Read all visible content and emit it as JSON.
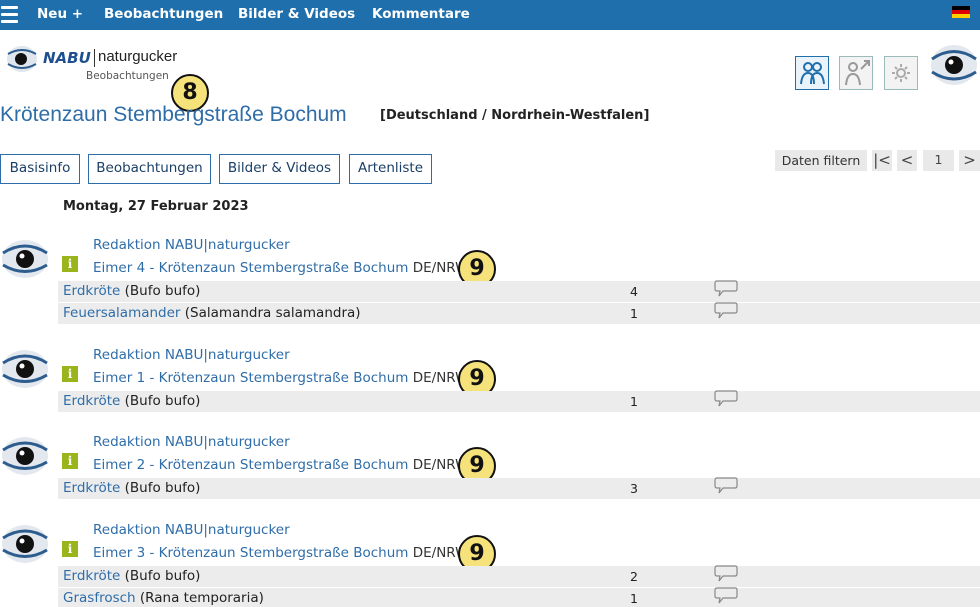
{
  "nav": {
    "items": [
      "Neu +",
      "Beobachtungen",
      "Bilder & Videos",
      "Kommentare"
    ],
    "language_flag": "flag-de-icon"
  },
  "logo": {
    "brand": "NABU",
    "product": "naturgucker",
    "subtitle": "Beobachtungen"
  },
  "markers": {
    "header": "8",
    "entry": "9"
  },
  "header": {
    "title": "Krötenzaun Stembergstraße Bochum",
    "region": "[Deutschland / Nordrhein-Westfalen]"
  },
  "tabs": [
    "Basisinfo",
    "Beobachtungen",
    "Bilder & Videos",
    "Artenliste"
  ],
  "filter": {
    "label": "Daten filtern",
    "first": "|<",
    "prev": "<",
    "page": "1",
    "next": ">"
  },
  "date_heading": "Montag, 27 Februar 2023",
  "entries": [
    {
      "observer": "Redaktion NABU|naturgucker",
      "location": "Eimer 4 - Krötenzaun Stembergstraße Bochum",
      "region": "DE/NRW",
      "species": [
        {
          "name": "Erdkröte",
          "latin": "(Bufo bufo)",
          "count": "4"
        },
        {
          "name": "Feuersalamander",
          "latin": "(Salamandra salamandra)",
          "count": "1"
        }
      ]
    },
    {
      "observer": "Redaktion NABU|naturgucker",
      "location": "Eimer 1 - Krötenzaun Stembergstraße Bochum",
      "region": "DE/NRW",
      "species": [
        {
          "name": "Erdkröte",
          "latin": "(Bufo bufo)",
          "count": "1"
        }
      ]
    },
    {
      "observer": "Redaktion NABU|naturgucker",
      "location": "Eimer 2 - Krötenzaun Stembergstraße Bochum",
      "region": "DE/NRW",
      "species": [
        {
          "name": "Erdkröte",
          "latin": "(Bufo bufo)",
          "count": "3"
        }
      ]
    },
    {
      "observer": "Redaktion NABU|naturgucker",
      "location": "Eimer 3 - Krötenzaun Stembergstraße Bochum",
      "region": "DE/NRW",
      "species": [
        {
          "name": "Erdkröte",
          "latin": "(Bufo bufo)",
          "count": "2"
        },
        {
          "name": "Grasfrosch",
          "latin": "(Rana temporaria)",
          "count": "1"
        }
      ]
    }
  ],
  "icons": {
    "info": "i",
    "header_buttons": [
      "group-users-icon",
      "user-export-icon",
      "settings-icon"
    ]
  },
  "colors": {
    "nav_bg": "#1f6fad",
    "link": "#2f6da8",
    "info_green": "#9ab41c",
    "marker_yellow": "#f6e27a",
    "row_bg": "#ececec"
  }
}
